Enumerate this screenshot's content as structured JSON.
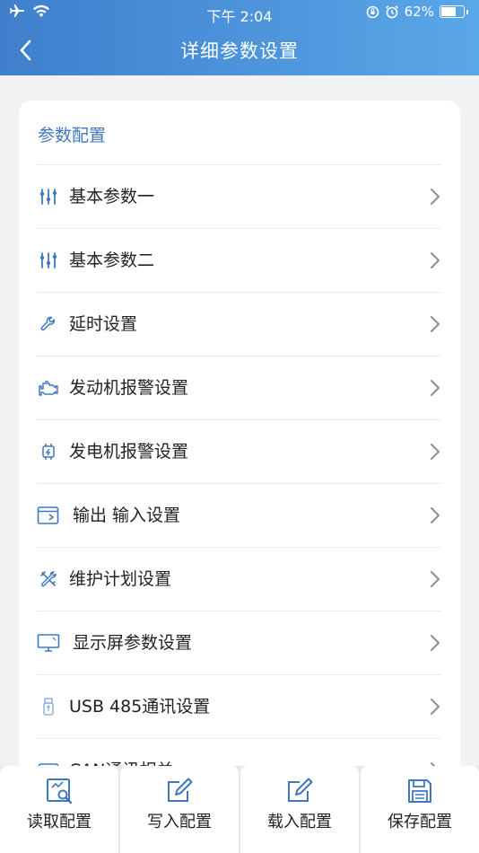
{
  "status": {
    "time": "下午 2:04",
    "battery": "62%"
  },
  "nav": {
    "title": "详细参数设置"
  },
  "section": {
    "title": "参数配置"
  },
  "items": [
    {
      "label": "基本参数一",
      "icon": "sliders-icon"
    },
    {
      "label": "基本参数二",
      "icon": "sliders-icon"
    },
    {
      "label": "延时设置",
      "icon": "wrench-icon"
    },
    {
      "label": "发动机报警设置",
      "icon": "engine-icon"
    },
    {
      "label": "发电机报警设置",
      "icon": "generator-icon"
    },
    {
      "label": "输出 输入设置",
      "icon": "io-window-icon"
    },
    {
      "label": "维护计划设置",
      "icon": "tools-icon"
    },
    {
      "label": "显示屏参数设置",
      "icon": "monitor-icon"
    },
    {
      "label": "USB 485通讯设置",
      "icon": "usb-icon"
    },
    {
      "label": "CAN通讯相关",
      "icon": "can-icon"
    }
  ],
  "bottom": {
    "read": "读取配置",
    "write": "写入配置",
    "load": "载入配置",
    "save": "保存配置"
  },
  "colors": {
    "accent": "#3f78bf",
    "header_start": "#3f7fcc",
    "header_end": "#5aa7e8"
  }
}
